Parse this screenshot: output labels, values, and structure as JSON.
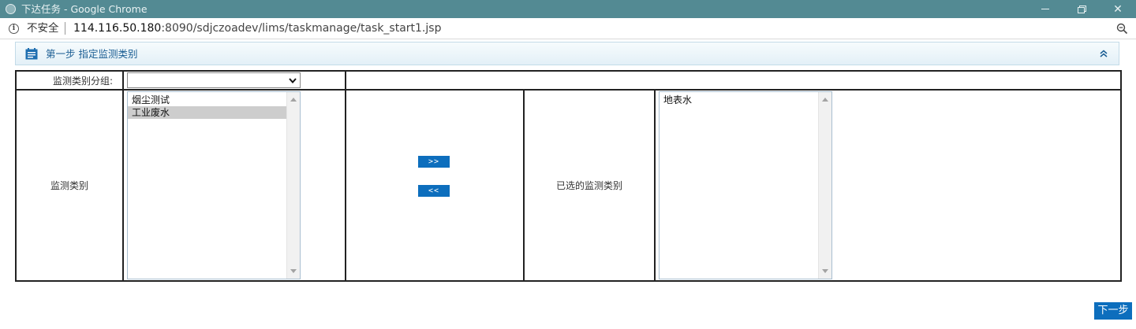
{
  "window": {
    "title": "下达任务 - Google Chrome"
  },
  "address_bar": {
    "security_label": "不安全",
    "url_host": "114.116.50.180",
    "url_rest": ":8090/sdjczoadev/lims/taskmanage/task_start1.jsp"
  },
  "section": {
    "title": "第一步 指定监测类别"
  },
  "form": {
    "group_label": "监测类别分组:",
    "group_select_value": "",
    "category_label": "监测类别",
    "available_items": [
      {
        "label": "烟尘测试",
        "selected": false
      },
      {
        "label": "工业废水",
        "selected": true
      }
    ],
    "add_button_label": ">>",
    "remove_button_label": "<<",
    "selected_label": "已选的监测类别",
    "selected_items": [
      {
        "label": "地表水",
        "selected": false
      }
    ]
  },
  "footer": {
    "next_button_label": "下一步"
  },
  "colors": {
    "titlebar": "#538a93",
    "button_blue": "#0d6ebd",
    "section_title": "#1a5d93"
  }
}
